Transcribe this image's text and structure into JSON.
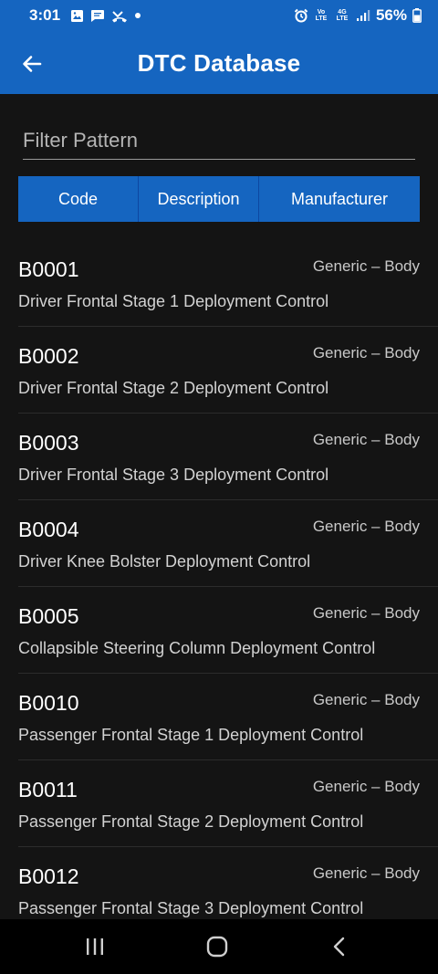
{
  "status_bar": {
    "time": "3:01",
    "battery": "56%",
    "left_icons": [
      "image-icon",
      "chat-icon",
      "missed-call-icon",
      "dot-icon"
    ],
    "right_icons": [
      "alarm-icon",
      "volte-icon",
      "4g-lte-icon",
      "signal-icon",
      "battery-icon"
    ],
    "volte_label": "Vo LTE",
    "lte_label": "4G LTE"
  },
  "app_bar": {
    "title": "DTC Database",
    "back_icon": "arrow-left-icon"
  },
  "filter": {
    "placeholder": "Filter Pattern",
    "value": ""
  },
  "sort_buttons": {
    "code": "Code",
    "description": "Description",
    "manufacturer": "Manufacturer"
  },
  "dtc_list": [
    {
      "code": "B0001",
      "category": "Generic – Body",
      "description": "Driver Frontal Stage 1 Deployment Control"
    },
    {
      "code": "B0002",
      "category": "Generic – Body",
      "description": "Driver Frontal Stage 2 Deployment Control"
    },
    {
      "code": "B0003",
      "category": "Generic – Body",
      "description": "Driver Frontal Stage 3 Deployment Control"
    },
    {
      "code": "B0004",
      "category": "Generic – Body",
      "description": "Driver Knee Bolster Deployment Control"
    },
    {
      "code": "B0005",
      "category": "Generic – Body",
      "description": "Collapsible Steering Column Deployment Control"
    },
    {
      "code": "B0010",
      "category": "Generic – Body",
      "description": "Passenger Frontal Stage 1 Deployment Control"
    },
    {
      "code": "B0011",
      "category": "Generic – Body",
      "description": "Passenger Frontal Stage 2 Deployment Control"
    },
    {
      "code": "B0012",
      "category": "Generic – Body",
      "description": "Passenger Frontal Stage 3 Deployment Control"
    }
  ],
  "nav_bar": {
    "icons": [
      "recent-apps-icon",
      "home-icon",
      "back-icon"
    ]
  },
  "colors": {
    "primary": "#1565c0",
    "background": "#141414",
    "divider": "#2c2c2c"
  }
}
